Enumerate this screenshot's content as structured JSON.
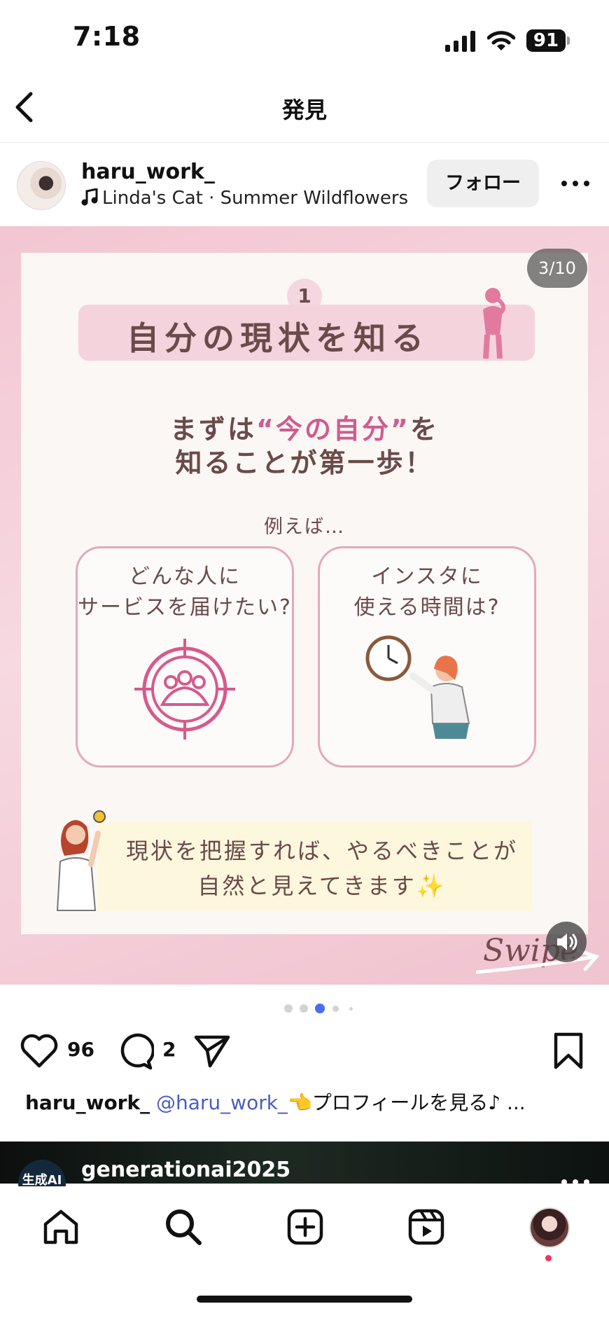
{
  "status_bar": {
    "time": "7:18",
    "battery": "91"
  },
  "header": {
    "title": "発見"
  },
  "post": {
    "username": "haru_work_",
    "music": "Linda's Cat · Summer Wildflowers",
    "follow_label": "フォロー",
    "counter": "3/10",
    "image": {
      "number": "1",
      "title": "自分の現状を知る",
      "subtitle_1a": "まずは",
      "subtitle_1b": "“今の自分”",
      "subtitle_1c": "を",
      "subtitle_2": "知ることが第一歩！",
      "example_label": "例えば…",
      "box1_line1": "どんな人に",
      "box1_line2": "サービスを届けたい?",
      "box2_line1": "インスタに",
      "box2_line2": "使える時間は?",
      "note_line1": "現状を把握すれば、やるべきことが",
      "note_line2": "自然と見えてきます✨",
      "swipe": "Swipe"
    },
    "likes": "96",
    "comments": "2",
    "caption_user": "haru_work_",
    "caption_mention": "@haru_work_",
    "caption_text": "👈プロフィールを見る♪ ..."
  },
  "next_post": {
    "username": "generationai2025",
    "avatar_text": "生成AI"
  },
  "colors": {
    "accent_pink": "#cf5c8f",
    "text_brown": "#6b4a4a",
    "active_dot": "#4a6cf0",
    "notification": "#ff2d55"
  }
}
